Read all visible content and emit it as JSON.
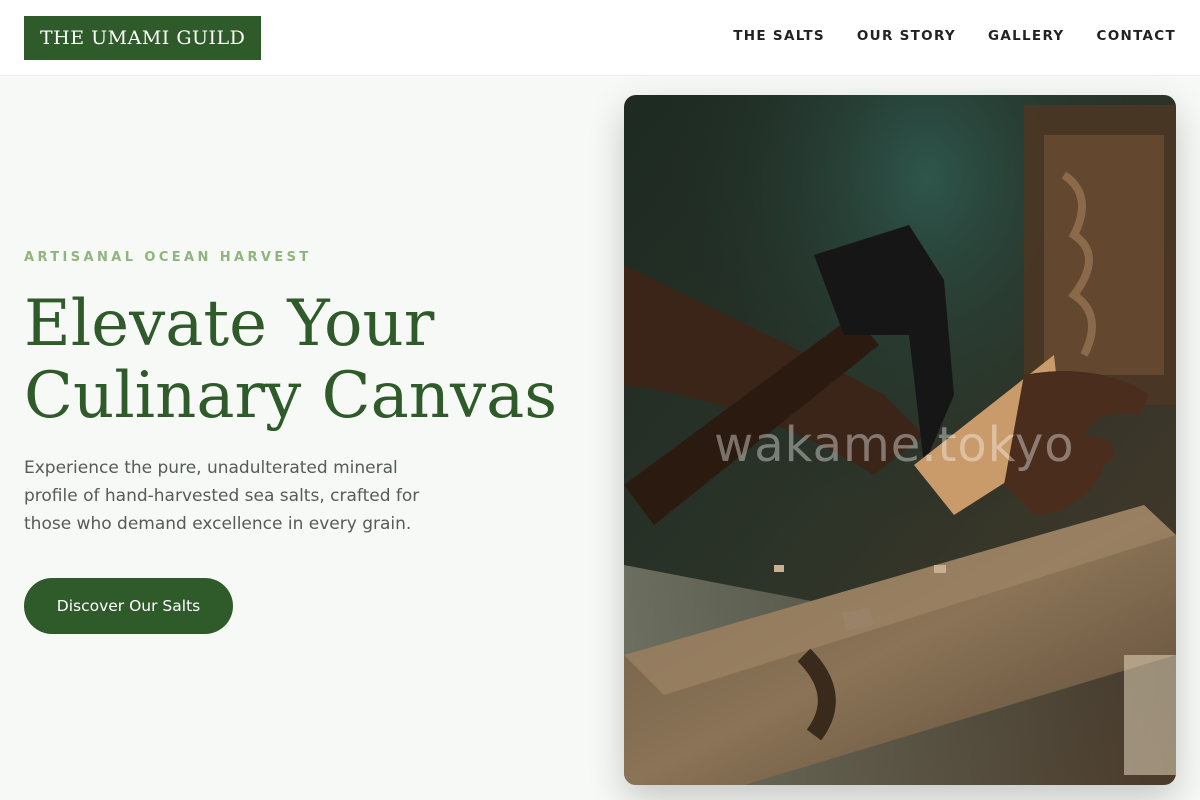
{
  "header": {
    "logo": "THE UMAMI GUILD",
    "nav": [
      "THE SALTS",
      "OUR STORY",
      "GALLERY",
      "CONTACT"
    ]
  },
  "hero": {
    "eyebrow": "ARTISANAL OCEAN HARVEST",
    "headline_line1": "Elevate Your",
    "headline_line2": "Culinary Canvas",
    "lead": "Experience the pure, unadulterated mineral profile of hand-harvested sea salts, crafted for those who demand excellence in every grain.",
    "cta": "Discover Our Salts",
    "image_watermark": "wakame.tokyo"
  },
  "colors": {
    "brand_green": "#2f5a29",
    "eyebrow_green": "#8fb47c",
    "page_background": "#f7f9f6"
  }
}
